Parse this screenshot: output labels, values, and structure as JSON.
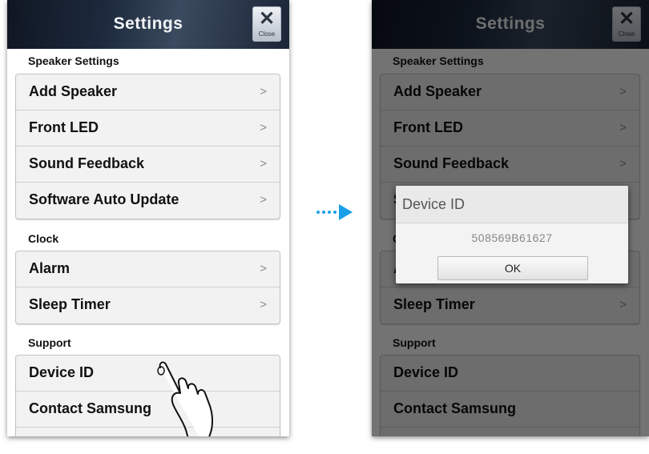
{
  "header": {
    "title": "Settings",
    "close_icon": "close-icon",
    "close_label": "Close"
  },
  "sections": [
    {
      "title": "Speaker Settings",
      "items": [
        {
          "label": "Add Speaker",
          "chevron": ">"
        },
        {
          "label": "Front LED",
          "chevron": ">"
        },
        {
          "label": "Sound Feedback",
          "chevron": ">"
        },
        {
          "label": "Software Auto Update",
          "chevron": ">"
        }
      ]
    },
    {
      "title": "Clock",
      "items": [
        {
          "label": "Alarm",
          "chevron": ">"
        },
        {
          "label": "Sleep Timer",
          "chevron": ">"
        }
      ]
    },
    {
      "title": "Support",
      "items": [
        {
          "label": "Device ID"
        },
        {
          "label": "Contact Samsung"
        }
      ]
    }
  ],
  "dialog": {
    "title": "Device ID",
    "value": "508569B61627",
    "ok_label": "OK"
  },
  "colors": {
    "accent_arrow": "#1aa0e8",
    "header_dark": "#1d2a3d"
  },
  "icons": {
    "tap_gesture": "hand-tap-icon",
    "transition": "arrow-right-icon"
  }
}
